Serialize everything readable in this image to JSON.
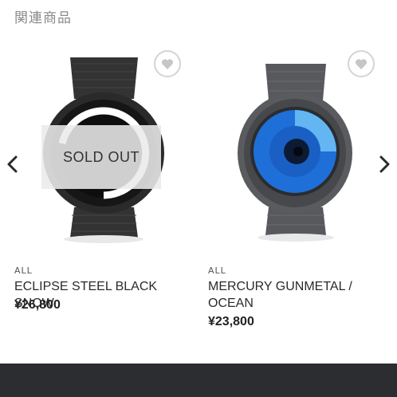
{
  "section": {
    "title": "関連商品"
  },
  "carousel": {
    "prev_icon": "chevron-left-icon",
    "next_icon": "chevron-right-icon",
    "products": [
      {
        "category": "ALL",
        "name": "ECLIPSE STEEL BLACK SNOW",
        "price": "¥26,800",
        "sold_out_label": "SOLD OUT",
        "favorite_icon": "heart-icon",
        "colors": {
          "body": "#2a2a2a",
          "dial": "#0e0e0e",
          "ring": "#ffffff"
        }
      },
      {
        "category": "ALL",
        "name": "MERCURY GUNMETAL / OCEAN",
        "price": "¥23,800",
        "favorite_icon": "heart-icon",
        "colors": {
          "body": "#5a5b5e",
          "dial": "#1f6fd8",
          "accent": "#63b6f2"
        }
      }
    ]
  },
  "footer": {
    "color": "#2c2d30"
  }
}
